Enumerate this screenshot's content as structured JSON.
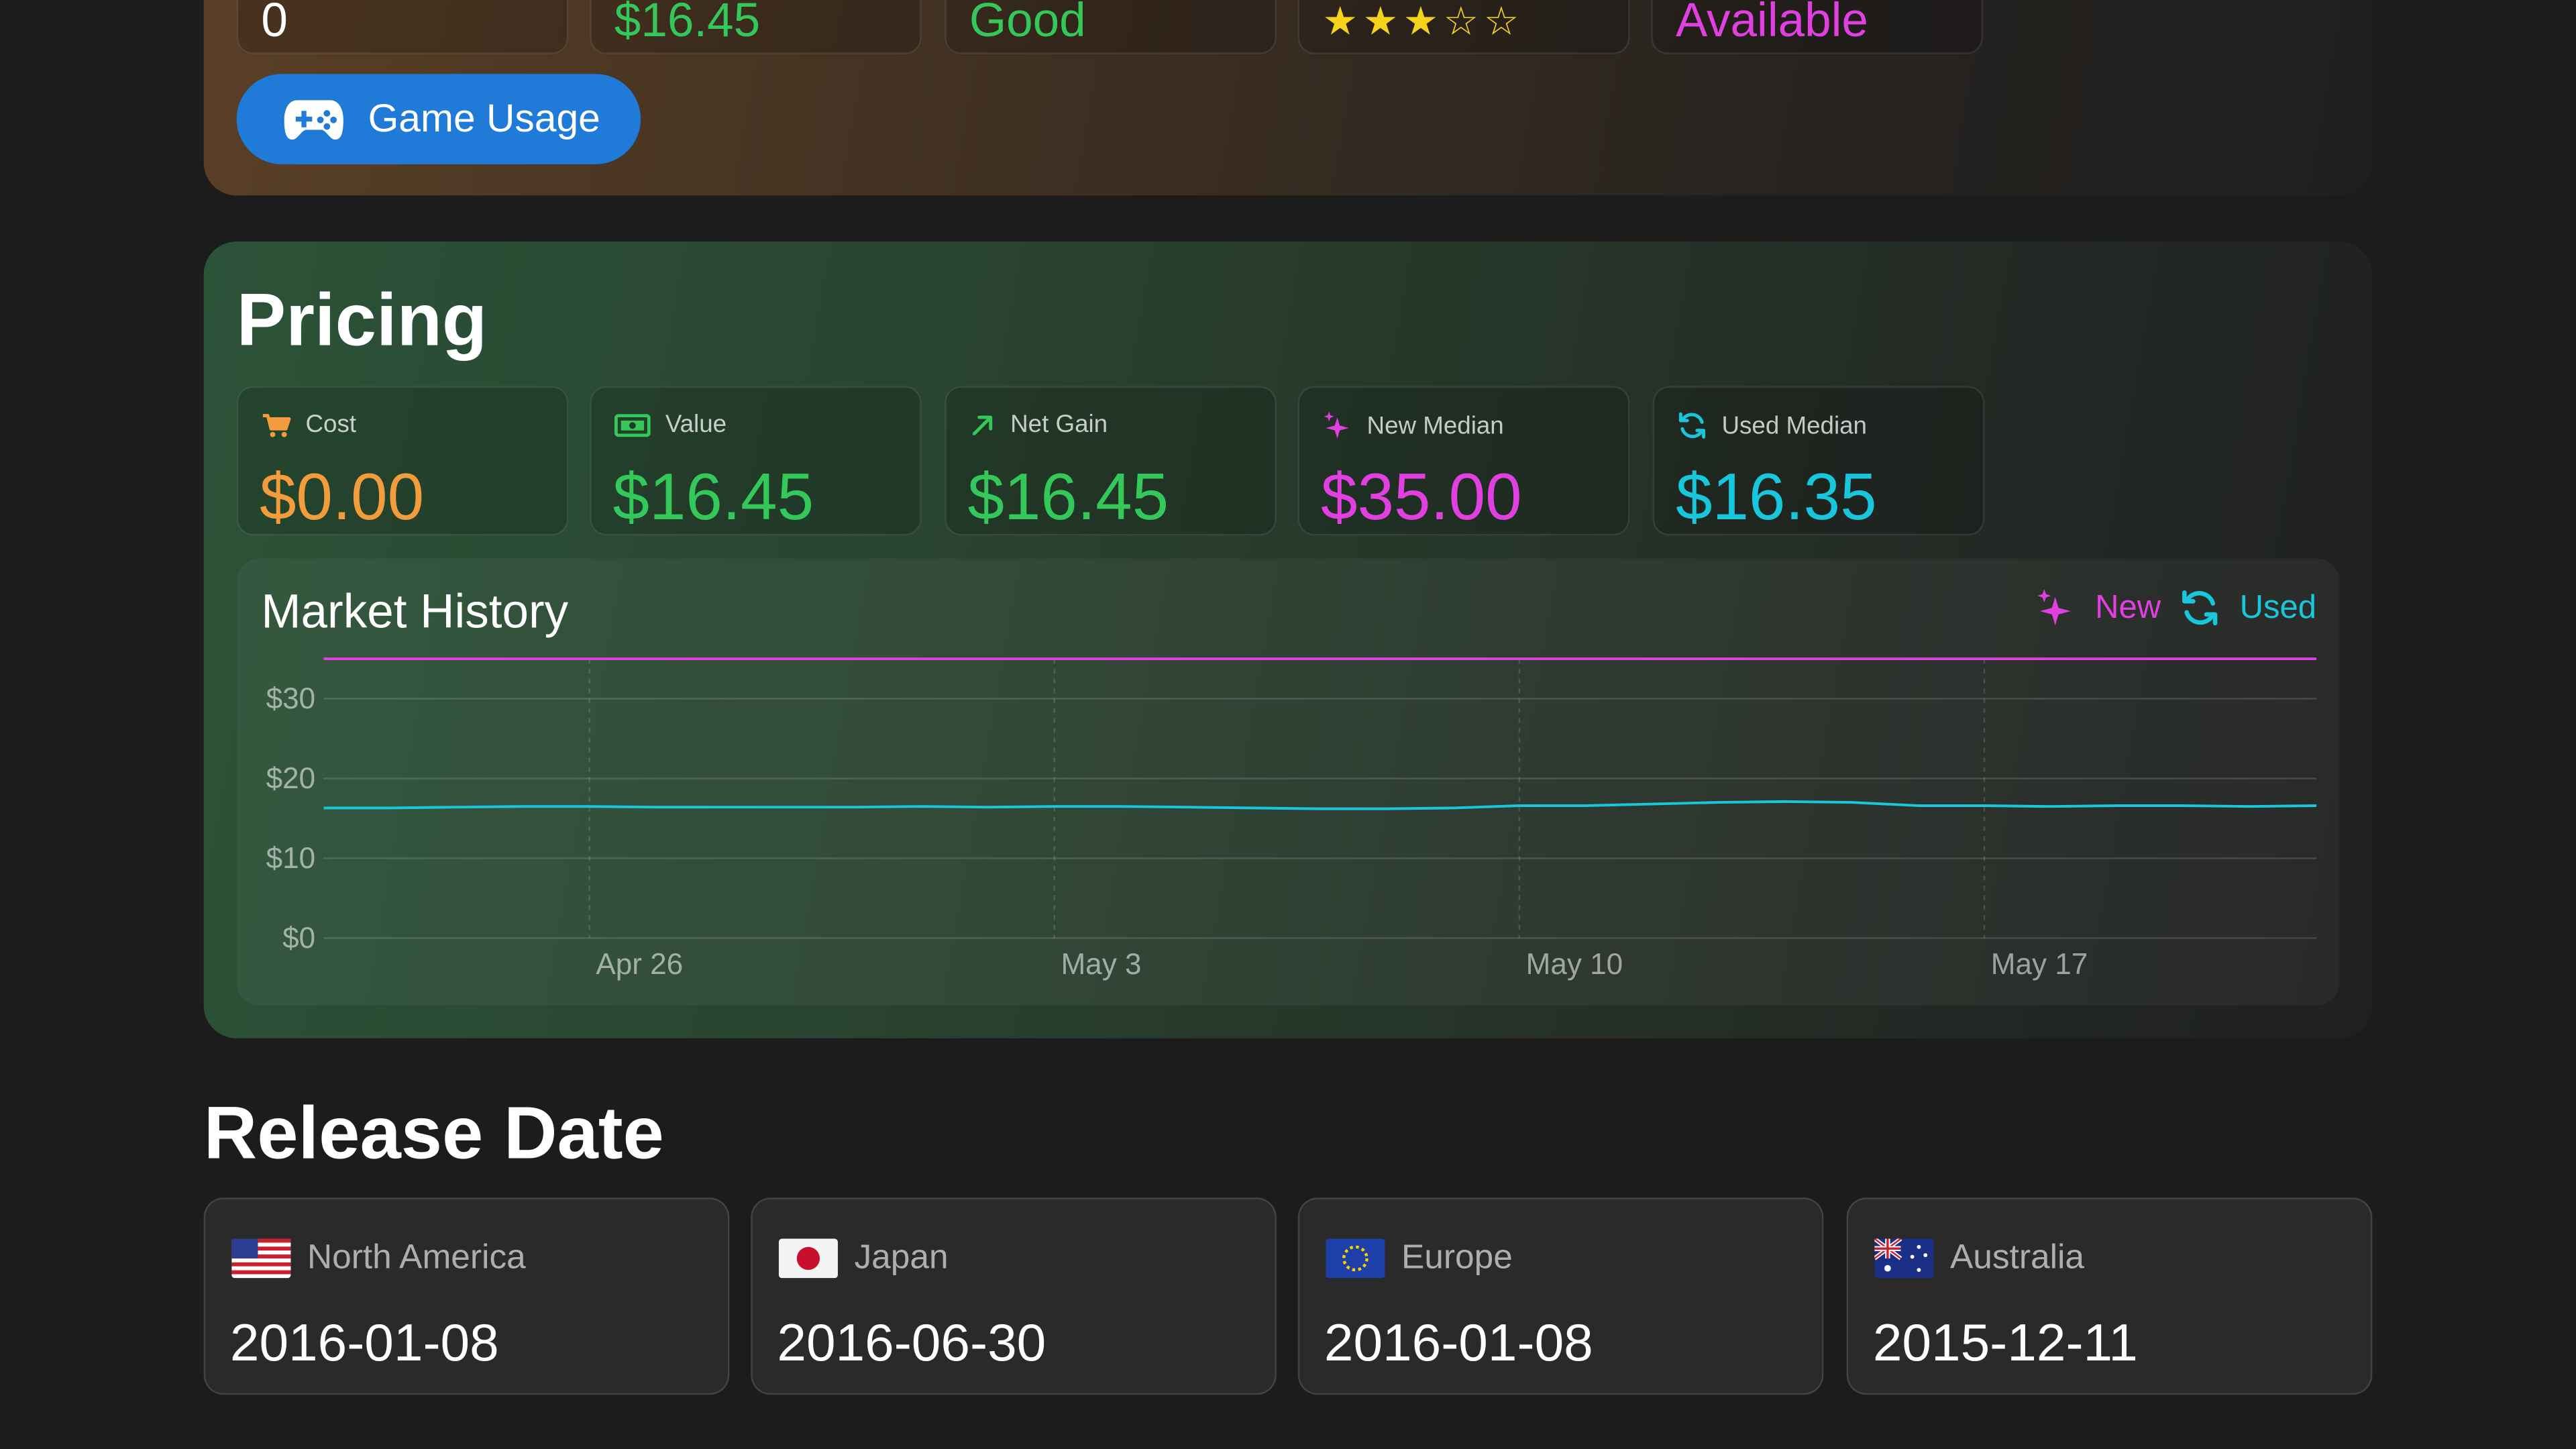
{
  "top_summary": {
    "cards": [
      {
        "value": "0",
        "color": "#ffffff"
      },
      {
        "value": "$16.45",
        "color": "#34c759"
      },
      {
        "value": "Good",
        "color": "#34c759"
      },
      {
        "stars_filled": 3,
        "stars_total": 5,
        "color": "#f6d31a"
      },
      {
        "value": "Available",
        "color": "#e040e0"
      }
    ],
    "game_usage_button": "Game Usage"
  },
  "pricing": {
    "title": "Pricing",
    "metrics": [
      {
        "label": "Cost",
        "value": "$0.00",
        "icon": "cart-icon",
        "color": "#f39c3c"
      },
      {
        "label": "Value",
        "value": "$16.45",
        "icon": "banknote-icon",
        "color": "#34c759"
      },
      {
        "label": "Net Gain",
        "value": "$16.45",
        "icon": "arrow-up-right-icon",
        "color": "#34c759"
      },
      {
        "label": "New Median",
        "value": "$35.00",
        "icon": "sparkles-icon",
        "color": "#e040e0"
      },
      {
        "label": "Used Median",
        "value": "$16.35",
        "icon": "refresh-icon",
        "color": "#19c7dc"
      }
    ],
    "history": {
      "title": "Market History",
      "legend": {
        "new": "New",
        "used": "Used"
      }
    }
  },
  "chart_data": {
    "type": "line",
    "title": "Market History",
    "x": [
      "Apr 22",
      "Apr 23",
      "Apr 24",
      "Apr 25",
      "Apr 26",
      "Apr 27",
      "Apr 28",
      "Apr 29",
      "Apr 30",
      "May 1",
      "May 2",
      "May 3",
      "May 4",
      "May 5",
      "May 6",
      "May 7",
      "May 8",
      "May 9",
      "May 10",
      "May 11",
      "May 12",
      "May 13",
      "May 14",
      "May 15",
      "May 16",
      "May 17",
      "May 18",
      "May 19",
      "May 20",
      "May 21",
      "May 22"
    ],
    "x_tick_labels": [
      "Apr 26",
      "May 3",
      "May 10",
      "May 17"
    ],
    "y_tick_labels": [
      "$0",
      "$10",
      "$20",
      "$30"
    ],
    "ylim": [
      0,
      35
    ],
    "series": [
      {
        "name": "New",
        "color": "#e040e0",
        "values": [
          35,
          35,
          35,
          35,
          35,
          35,
          35,
          35,
          35,
          35,
          35,
          35,
          35,
          35,
          35,
          35,
          35,
          35,
          35,
          35,
          35,
          35,
          35,
          35,
          35,
          35,
          35,
          35,
          35,
          35,
          35
        ]
      },
      {
        "name": "Used",
        "color": "#19c7dc",
        "values": [
          16.3,
          16.3,
          16.4,
          16.5,
          16.5,
          16.4,
          16.4,
          16.4,
          16.4,
          16.5,
          16.4,
          16.5,
          16.5,
          16.4,
          16.3,
          16.2,
          16.2,
          16.3,
          16.6,
          16.6,
          16.8,
          17.0,
          17.1,
          17.0,
          16.6,
          16.6,
          16.5,
          16.6,
          16.6,
          16.5,
          16.6
        ]
      }
    ],
    "grid": true,
    "legend_position": "top-right"
  },
  "release": {
    "title": "Release Date",
    "regions": [
      {
        "name": "North America",
        "date": "2016-01-08",
        "flag": "us-flag-icon"
      },
      {
        "name": "Japan",
        "date": "2016-06-30",
        "flag": "japan-flag-icon"
      },
      {
        "name": "Europe",
        "date": "2016-01-08",
        "flag": "eu-flag-icon"
      },
      {
        "name": "Australia",
        "date": "2015-12-11",
        "flag": "australia-flag-icon"
      }
    ]
  }
}
